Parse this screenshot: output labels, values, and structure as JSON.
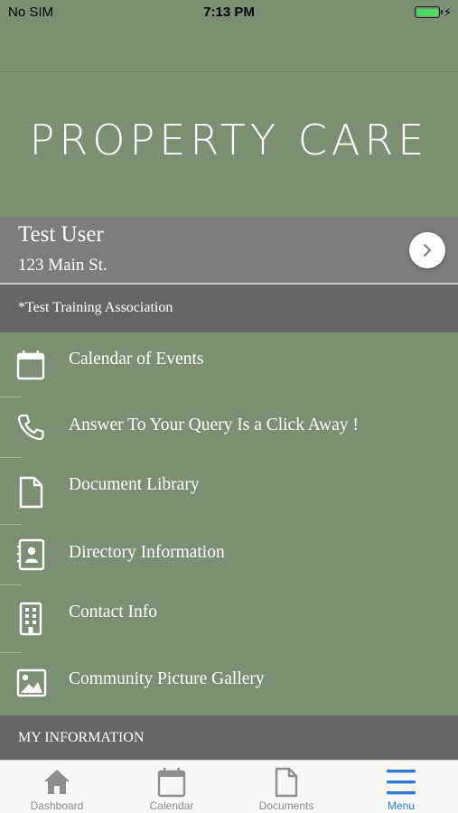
{
  "status_bar": {
    "carrier": "No SIM",
    "time": "7:13 PM",
    "battery_level": 1.0,
    "charging_icon": "charging-bolt-icon",
    "battery_color": "#4cd964"
  },
  "brand": {
    "title": "PROPERTY CARE"
  },
  "user": {
    "name": "Test User",
    "address": "123 Main St.",
    "arrow_icon": "chevron-right-icon"
  },
  "association": {
    "label": "*Test Training Association"
  },
  "menu": {
    "items": [
      {
        "label": "Calendar of Events",
        "icon": "calendar-icon"
      },
      {
        "label": "Answer To Your Query Is a Click Away !",
        "icon": "phone-icon"
      },
      {
        "label": "Document Library",
        "icon": "document-icon"
      },
      {
        "label": "Directory Information",
        "icon": "contact-card-icon"
      },
      {
        "label": "Contact Info",
        "icon": "building-icon"
      },
      {
        "label": "Community Picture Gallery",
        "icon": "picture-icon"
      }
    ]
  },
  "my_information": {
    "label": "MY INFORMATION"
  },
  "tab_bar": {
    "tabs": [
      {
        "label": "Dashboard",
        "icon": "home-icon",
        "active": false
      },
      {
        "label": "Calendar",
        "icon": "calendar-icon",
        "active": false
      },
      {
        "label": "Documents",
        "icon": "document-icon",
        "active": false
      },
      {
        "label": "Menu",
        "icon": "menu-icon",
        "active": true
      }
    ],
    "active_color": "#2f7bd6",
    "inactive_color": "#8e8e8e"
  },
  "colors": {
    "background": "#7d8f72",
    "user_card": "#7d7d7b",
    "section_header": "#666665"
  }
}
